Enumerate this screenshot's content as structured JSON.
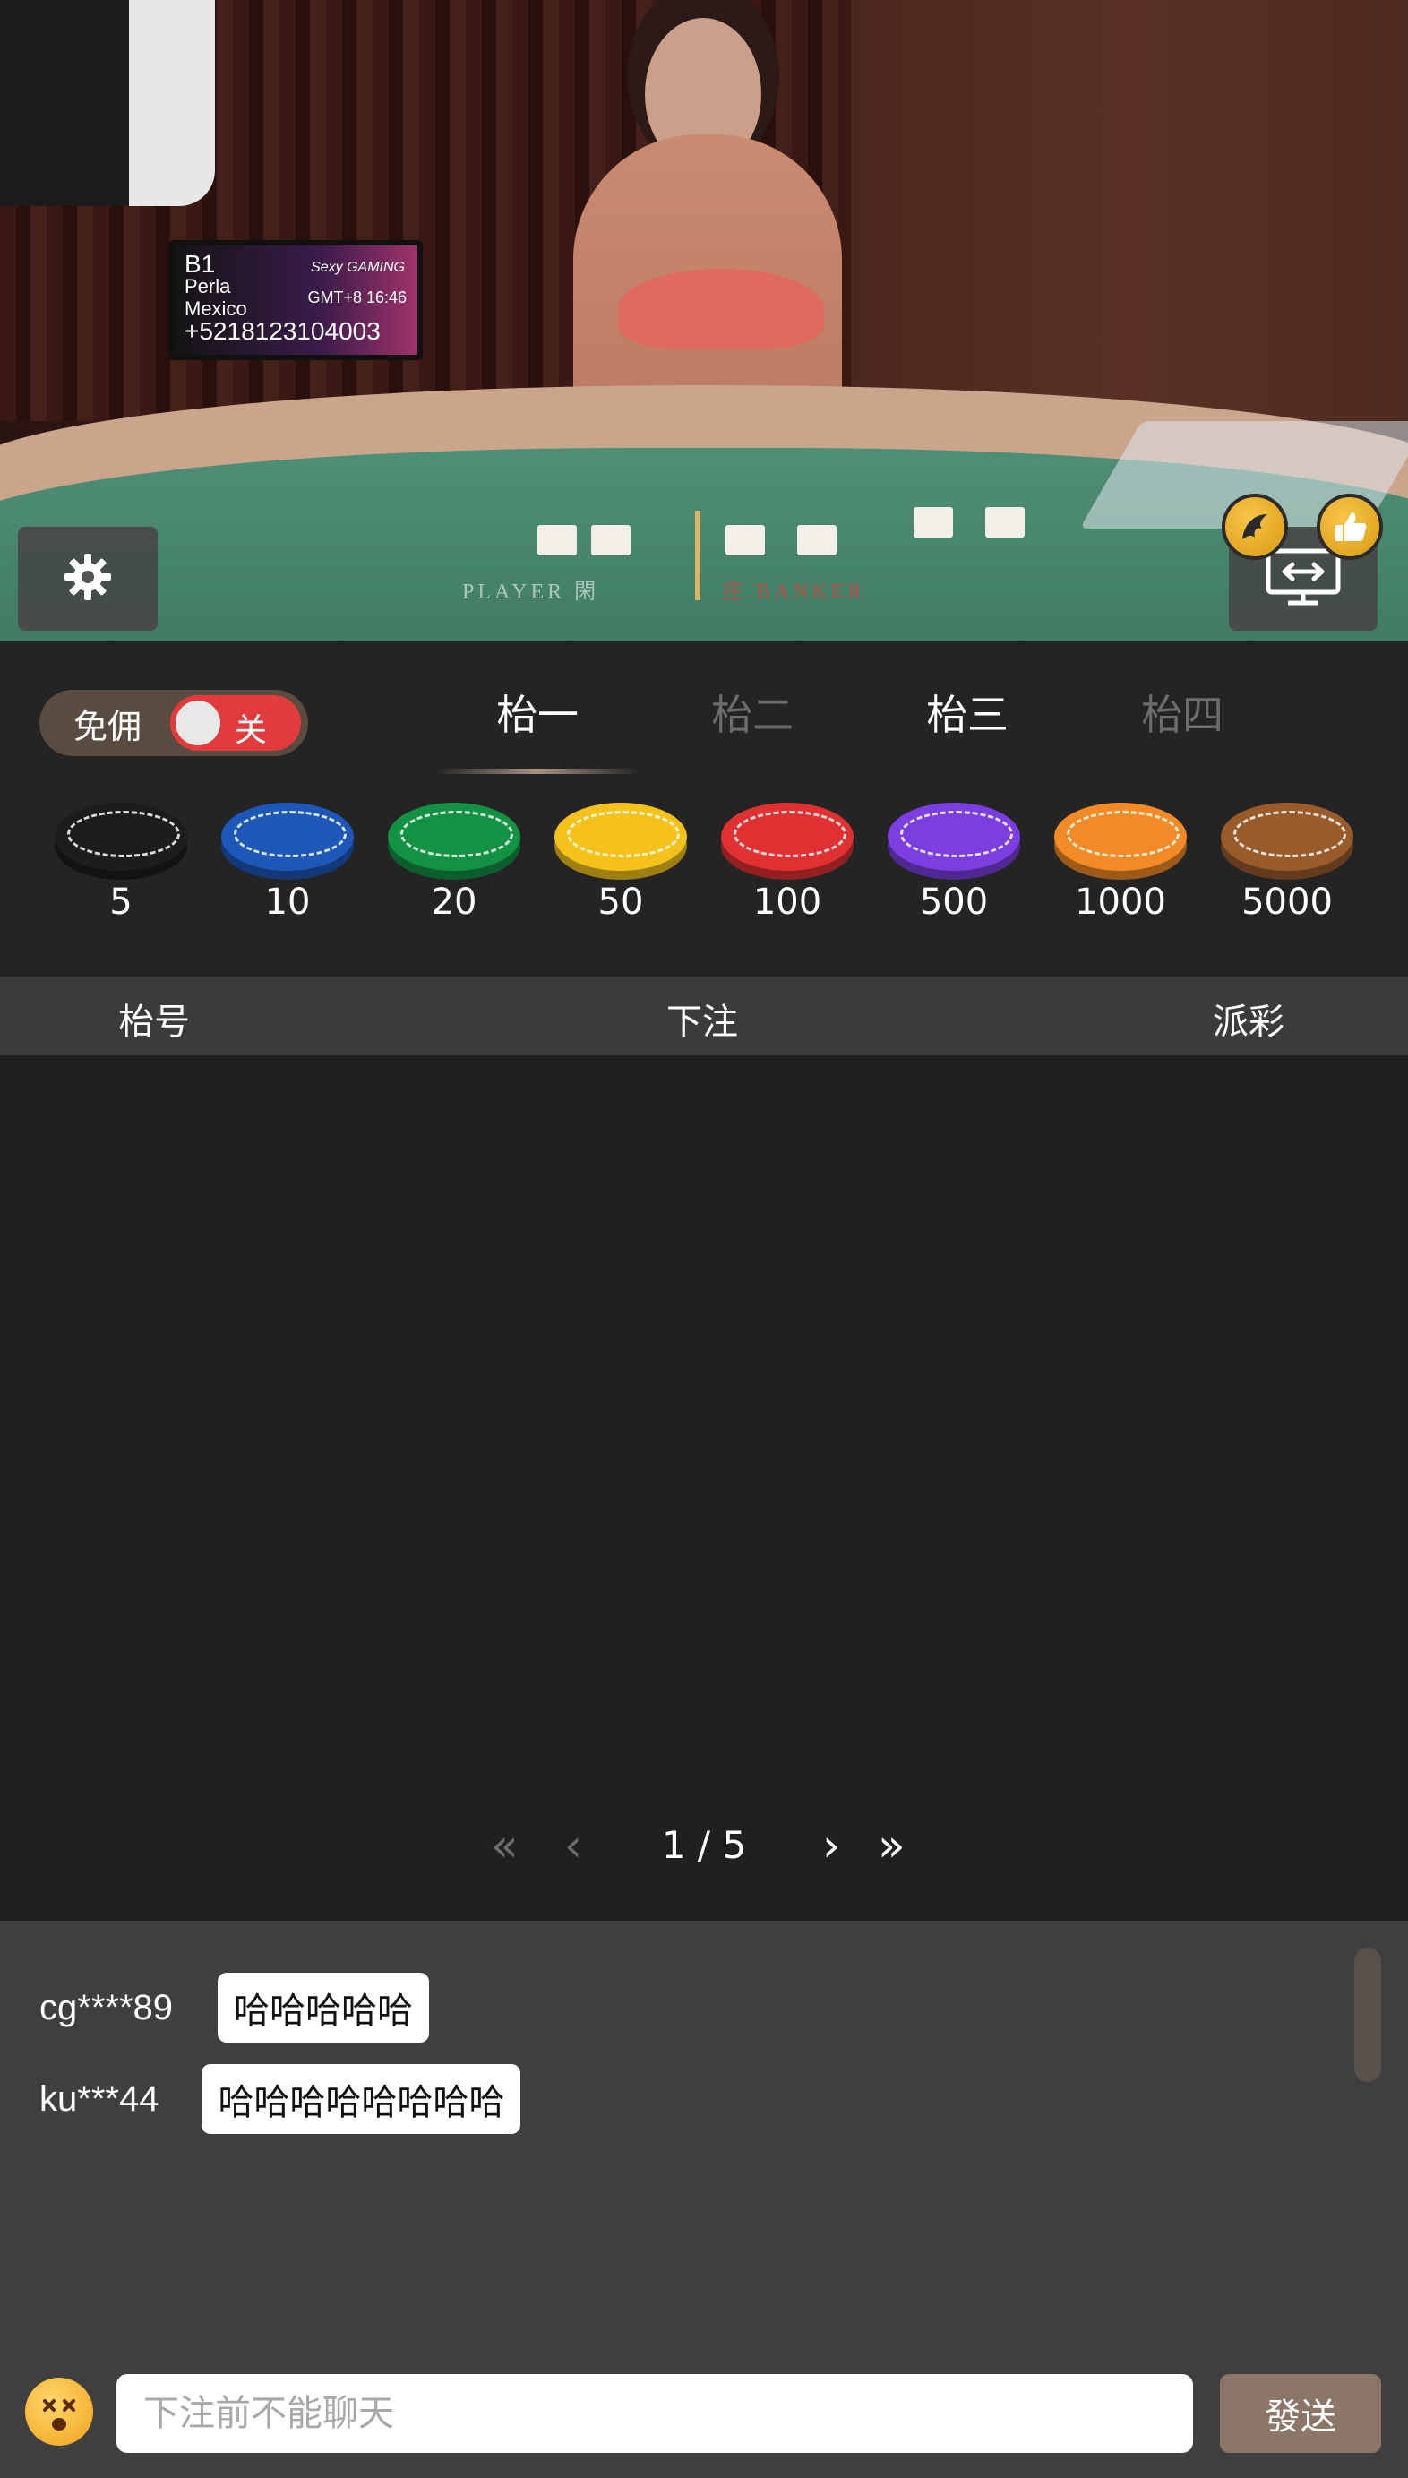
{
  "video": {
    "monitor": {
      "table_id": "B1",
      "dealer_name": "Perla",
      "country": "Mexico",
      "phone": "+5218123104003",
      "time": "GMT+8 16:46",
      "brand": "Sexy GAMING"
    },
    "felt_labels": {
      "player": "PLAYER 閑",
      "banker": "庄 BANKER"
    },
    "icons": {
      "settings": "gear-icon",
      "swap": "screen-swap-icon",
      "dragon": "dragon-badge-icon",
      "like": "thumbs-up-icon"
    }
  },
  "toolbar": {
    "commission_label": "免佣",
    "commission_toggle": "关",
    "commission_on": false,
    "tabs": [
      {
        "label": "枱一",
        "active": true
      },
      {
        "label": "枱二",
        "active": false
      },
      {
        "label": "枱三",
        "active": false
      },
      {
        "label": "枱四",
        "active": false
      }
    ],
    "chips": [
      {
        "value": "5",
        "color": "#1d1d1d"
      },
      {
        "value": "10",
        "color": "#1d57b8"
      },
      {
        "value": "20",
        "color": "#139243"
      },
      {
        "value": "50",
        "color": "#f4c21b"
      },
      {
        "value": "100",
        "color": "#e03132"
      },
      {
        "value": "500",
        "color": "#7b3ee0"
      },
      {
        "value": "1000",
        "color": "#f28a26"
      },
      {
        "value": "5000",
        "color": "#9a5b2b"
      }
    ]
  },
  "table_header": {
    "col_table": "枱号",
    "col_bet": "下注",
    "col_payout": "派彩"
  },
  "pagination": {
    "current": "1",
    "separator": "/",
    "total": "5",
    "first": "«",
    "prev": "‹",
    "next": "›",
    "last": "»"
  },
  "chat": {
    "messages": [
      {
        "user": "cg****89",
        "text": "哈哈哈哈哈"
      },
      {
        "user": "ku***44",
        "text": "哈哈哈哈哈哈哈哈"
      }
    ],
    "input_placeholder": "下注前不能聊天",
    "send_label": "發送",
    "emoji_icon": "dizzy-face-emoji-icon"
  },
  "colors": {
    "accent": "#8b7667",
    "toggle_off": "#e23b3b",
    "panel": "#242425",
    "chat_bg": "#3f3f40"
  }
}
